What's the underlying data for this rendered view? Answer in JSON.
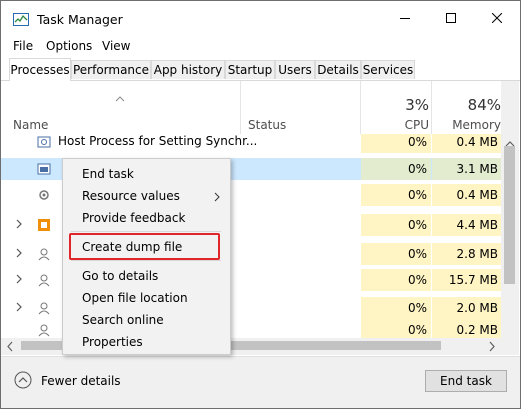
{
  "window": {
    "title": "Task Manager",
    "buttons": [
      "minimize",
      "maximize",
      "close"
    ]
  },
  "menu": [
    "File",
    "Options",
    "View"
  ],
  "tabs": [
    "Processes",
    "Performance",
    "App history",
    "Startup",
    "Users",
    "Details",
    "Services"
  ],
  "active_tab": "Processes",
  "columns": {
    "name": "Name",
    "status": "Status",
    "cpu": {
      "percent": "3%",
      "label": "CPU"
    },
    "memory": {
      "percent": "84%",
      "label": "Memory"
    }
  },
  "rows": [
    {
      "name": "Host Process for Setting Synchr...",
      "cpu": "0%",
      "memory": "0.4 MB",
      "icon": "gear-window-icon",
      "selected": false
    },
    {
      "name": "",
      "cpu": "0%",
      "memory": "3.1 MB",
      "icon": "window-icon",
      "selected": true
    },
    {
      "name": "",
      "cpu": "0%",
      "memory": "0.4 MB",
      "icon": "service-gear-icon",
      "selected": false
    },
    {
      "name": "",
      "cpu": "0%",
      "memory": "4.4 MB",
      "icon": "orange-app-icon",
      "selected": false
    },
    {
      "name": "",
      "cpu": "0%",
      "memory": "2.8 MB",
      "icon": "user-icon",
      "selected": false
    },
    {
      "name": "",
      "cpu": "0%",
      "memory": "15.7 MB",
      "icon": "user-icon",
      "selected": false
    },
    {
      "name": "",
      "cpu": "0%",
      "memory": "2.0 MB",
      "icon": "user-icon",
      "selected": false
    },
    {
      "name": "",
      "cpu": "0%",
      "memory": "0.2 MB",
      "icon": "user-icon",
      "selected": false
    },
    {
      "name": "",
      "cpu": "0%",
      "memory": "0.6 MB",
      "icon": "user-icon",
      "selected": false
    }
  ],
  "context_menu": {
    "items": [
      "End task",
      "Resource values",
      "Provide feedback",
      "Create dump file",
      "Go to details",
      "Open file location",
      "Search online",
      "Properties"
    ],
    "highlighted": "Create dump file",
    "highlight_color": "#e0262a"
  },
  "footer": {
    "fewer_details": "Fewer details",
    "end_task": "End task"
  },
  "colors": {
    "cpu_memory_bg": "#fff4c4",
    "selected_row": "#cce8ff"
  }
}
